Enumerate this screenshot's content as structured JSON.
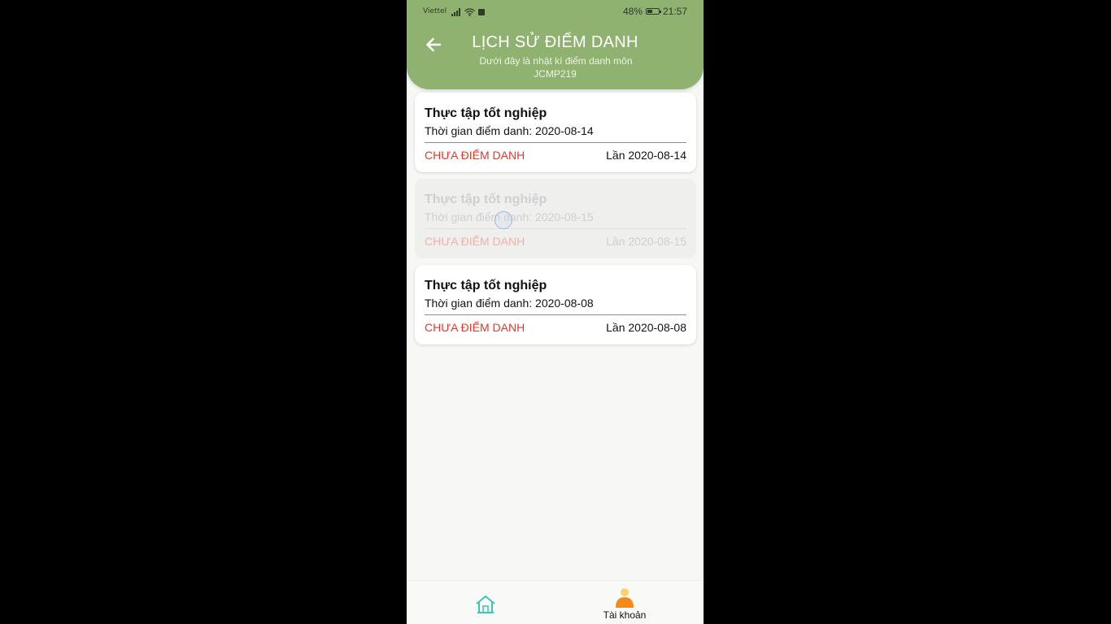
{
  "status_bar": {
    "carrier": "Viettel",
    "battery_percent": "48%",
    "battery_level": 0.48,
    "time": "21:57"
  },
  "header": {
    "title": "LỊCH SỬ ĐIỂM DANH",
    "subtitle_line1": "Dưới đây là nhật kí điểm danh môn",
    "subtitle_line2": "JCMP219"
  },
  "records": [
    {
      "title": "Thực tập tốt nghiệp",
      "time": "Thời gian điểm danh: 2020-08-14",
      "status": "CHƯA ĐIỂM DANH",
      "count": "Lần 2020-08-14"
    },
    {
      "title": "Thực tập tốt nghiệp",
      "time": "Thời gian điểm danh: 2020-08-15",
      "status": "CHƯA ĐIỂM DANH",
      "count": "Lần 2020-08-15"
    },
    {
      "title": "Thực tập tốt nghiệp",
      "time": "Thời gian điểm danh: 2020-08-08",
      "status": "CHƯA ĐIỂM DANH",
      "count": "Lần 2020-08-08"
    }
  ],
  "bottom_nav": {
    "home_icon": "home-icon",
    "account_label": "Tài khoản",
    "account_icon": "user-avatar-icon"
  },
  "colors": {
    "header": "#8fb270",
    "status_red": "#e0392b",
    "home_icon": "#3cc7b4",
    "avatar_body": "#f28a1e",
    "avatar_head": "#fbd36a"
  }
}
